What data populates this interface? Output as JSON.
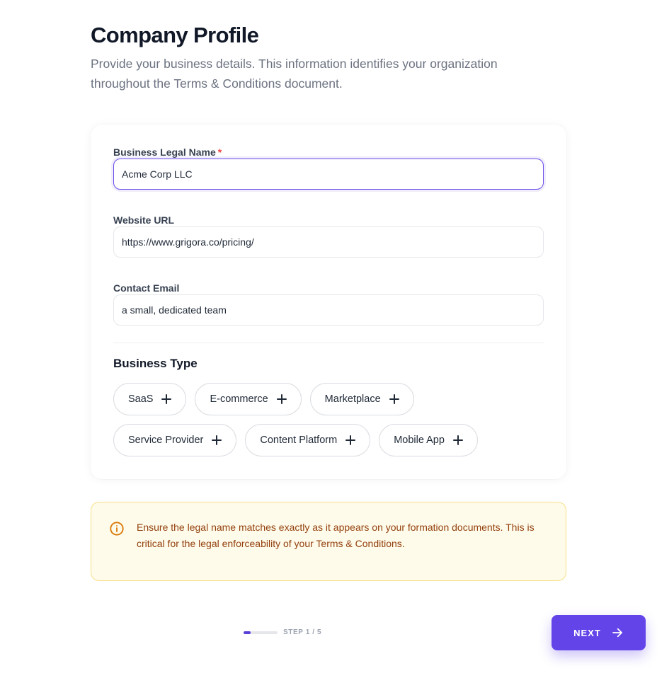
{
  "header": {
    "title": "Company Profile",
    "subtitle": "Provide your business details. This information identifies your organization throughout the Terms & Conditions document."
  },
  "form": {
    "business_name": {
      "label": "Business Legal Name",
      "required_mark": "*",
      "value": "Acme Corp LLC"
    },
    "website": {
      "label": "Website URL",
      "value": "https://www.grigora.co/pricing/"
    },
    "email": {
      "label": "Contact Email",
      "value": "a small, dedicated team"
    }
  },
  "business_type": {
    "title": "Business Type",
    "options": [
      "SaaS",
      "E-commerce",
      "Marketplace",
      "Service Provider",
      "Content Platform",
      "Mobile App"
    ],
    "option_icon": "plus-icon"
  },
  "notice": {
    "icon": "info-icon",
    "text": "Ensure the legal name matches exactly as it appears on your formation documents. This is critical for the legal enforceability of your Terms & Conditions."
  },
  "footer": {
    "step_label": "STEP 1 / 5",
    "progress": 0.2,
    "next_label": "NEXT",
    "next_icon": "arrow-right-icon"
  },
  "colors": {
    "accent": "#6344e9",
    "required": "#ef4444",
    "notice_bg": "#fffbea",
    "notice_border": "#f5e08a",
    "notice_text": "#92400e",
    "notice_icon": "#d97706"
  }
}
